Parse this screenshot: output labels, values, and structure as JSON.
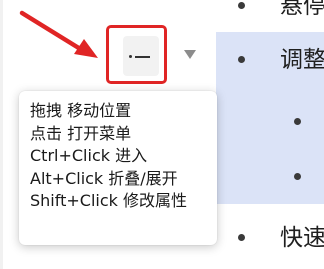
{
  "outline": {
    "row_top": "悬停",
    "row_selected": "调整",
    "row_bottom": "快速"
  },
  "handle": {
    "icon": "drag-handle-icon",
    "highlight_color": "#e02525"
  },
  "annotation": {
    "arrow_color": "#e02525"
  },
  "tooltip": {
    "lines": [
      "拖拽 移动位置",
      "点击 打开菜单",
      "Ctrl+Click 进入",
      "Alt+Click 折叠/展开",
      "Shift+Click 修改属性"
    ]
  },
  "colors": {
    "selection_bg": "#dbe3f7"
  }
}
